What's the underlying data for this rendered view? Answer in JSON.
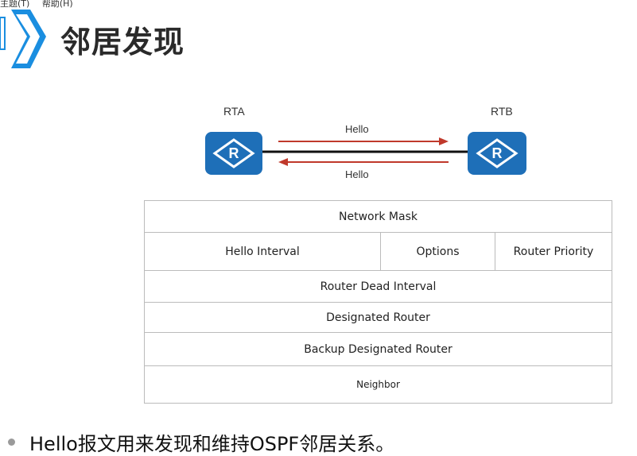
{
  "menubar": {
    "theme": "主题(T)",
    "help": "帮助(H)"
  },
  "slide": {
    "title": "邻居发现"
  },
  "diagram": {
    "router_a": "RTA",
    "router_b": "RTB",
    "router_icon_letter": "R",
    "hello_top": "Hello",
    "hello_bottom": "Hello",
    "arrow_color": "#c0392b",
    "router_color": "#1e6fb8"
  },
  "packet": {
    "network_mask": "Network Mask",
    "hello_interval": "Hello Interval",
    "options": "Options",
    "router_priority": "Router Priority",
    "router_dead_interval": "Router Dead Interval",
    "designated_router": "Designated Router",
    "backup_designated_router": "Backup Designated Router",
    "neighbor": "Neighbor"
  },
  "bullet": {
    "text": "Hello报文用来发现和维持OSPF邻居关系。"
  }
}
